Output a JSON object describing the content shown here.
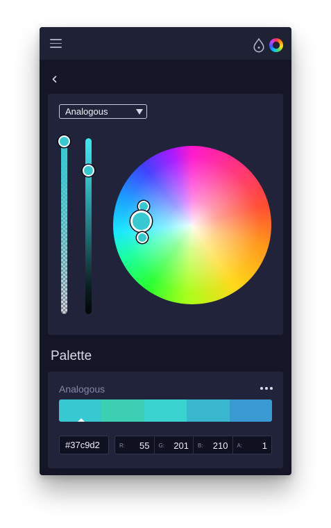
{
  "toolbar": {
    "menu_icon": "hamburger-menu-icon",
    "drop_icon": "color-drop-icon",
    "wheel_icon": "color-wheel-icon"
  },
  "navigation": {
    "back_icon": "chevron-left-icon"
  },
  "picker": {
    "harmony_mode": "Analogous",
    "selected_color": "#37c9d2",
    "alpha": 1,
    "value_fraction": 0.82
  },
  "palette": {
    "heading": "Palette",
    "name": "Analogous",
    "more_icon": "more-dots-icon",
    "swatches": [
      "#37c9d2",
      "#3ccfb2",
      "#3bd3d0",
      "#38b7cf",
      "#3a9bd4"
    ],
    "selected_swatch": 0,
    "hex": "#37c9d2",
    "rgba": [
      {
        "label": "R:",
        "value": "55"
      },
      {
        "label": "G:",
        "value": "201"
      },
      {
        "label": "B:",
        "value": "210"
      },
      {
        "label": "A:",
        "value": "1"
      }
    ]
  }
}
